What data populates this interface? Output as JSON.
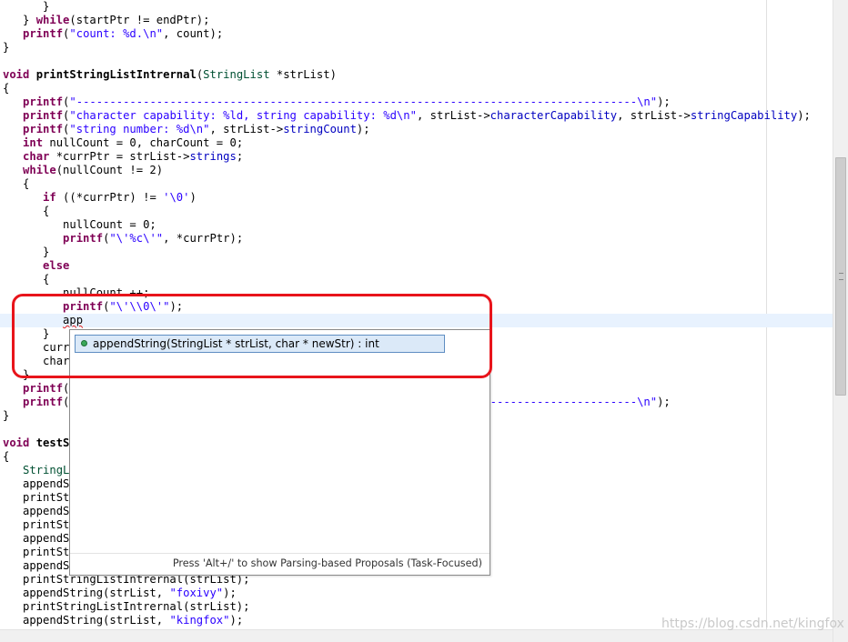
{
  "editor": {
    "lines": [
      [
        {
          "t": "      }"
        }
      ],
      [
        {
          "t": "   } "
        },
        {
          "t": "while",
          "c": "kw"
        },
        {
          "t": "(startPtr != endPtr);"
        }
      ],
      [
        {
          "t": "   printf",
          "c": "kw"
        },
        {
          "t": "("
        },
        {
          "t": "\"count: %d.\\n\"",
          "c": "str"
        },
        {
          "t": ", count);"
        }
      ],
      [
        {
          "t": "}"
        }
      ],
      [
        {
          "t": ""
        }
      ],
      [
        {
          "t": "void",
          "c": "kw"
        },
        {
          "t": " "
        },
        {
          "t": "printStringListIntrernal",
          "c": "fnd"
        },
        {
          "t": "("
        },
        {
          "t": "StringList",
          "c": "typ"
        },
        {
          "t": " *strList)"
        }
      ],
      [
        {
          "t": "{"
        }
      ],
      [
        {
          "t": "   "
        },
        {
          "t": "printf",
          "c": "kw"
        },
        {
          "t": "("
        },
        {
          "t": "\"------------------------------------------------------------------------------------\\n\"",
          "c": "str"
        },
        {
          "t": ");"
        }
      ],
      [
        {
          "t": "   "
        },
        {
          "t": "printf",
          "c": "kw"
        },
        {
          "t": "("
        },
        {
          "t": "\"character capability: %ld, string capability: %d\\n\"",
          "c": "str"
        },
        {
          "t": ", strList->"
        },
        {
          "t": "characterCapability",
          "c": "fld"
        },
        {
          "t": ", strList->"
        },
        {
          "t": "stringCapability",
          "c": "fld"
        },
        {
          "t": ");"
        }
      ],
      [
        {
          "t": "   "
        },
        {
          "t": "printf",
          "c": "kw"
        },
        {
          "t": "("
        },
        {
          "t": "\"string number: %d\\n\"",
          "c": "str"
        },
        {
          "t": ", strList->"
        },
        {
          "t": "stringCount",
          "c": "fld"
        },
        {
          "t": ");"
        }
      ],
      [
        {
          "t": "   "
        },
        {
          "t": "int",
          "c": "kw"
        },
        {
          "t": " nullCount = 0, charCount = 0;"
        }
      ],
      [
        {
          "t": "   "
        },
        {
          "t": "char",
          "c": "kw"
        },
        {
          "t": " *currPtr = strList->"
        },
        {
          "t": "strings",
          "c": "fld"
        },
        {
          "t": ";"
        }
      ],
      [
        {
          "t": "   "
        },
        {
          "t": "while",
          "c": "kw"
        },
        {
          "t": "(nullCount != 2)"
        }
      ],
      [
        {
          "t": "   {"
        }
      ],
      [
        {
          "t": "      "
        },
        {
          "t": "if",
          "c": "kw"
        },
        {
          "t": " ((*currPtr) != "
        },
        {
          "t": "'\\0'",
          "c": "str"
        },
        {
          "t": ")"
        }
      ],
      [
        {
          "t": "      {"
        }
      ],
      [
        {
          "t": "         nullCount = 0;"
        }
      ],
      [
        {
          "t": "         "
        },
        {
          "t": "printf",
          "c": "kw"
        },
        {
          "t": "("
        },
        {
          "t": "\"\\'%c\\'\"",
          "c": "str"
        },
        {
          "t": ", *currPtr);"
        }
      ],
      [
        {
          "t": "      }"
        }
      ],
      [
        {
          "t": "      "
        },
        {
          "t": "else",
          "c": "kw"
        }
      ],
      [
        {
          "t": "      {"
        }
      ],
      [
        {
          "t": "         nullCount ++;"
        }
      ],
      [
        {
          "t": "         "
        },
        {
          "t": "printf",
          "c": "kw"
        },
        {
          "t": "("
        },
        {
          "t": "\"\\'\\\\0\\'\"",
          "c": "str"
        },
        {
          "t": ");"
        }
      ],
      [
        {
          "t": "         "
        },
        {
          "t": "app",
          "c": "squig"
        }
      ],
      [
        {
          "t": "      }"
        }
      ],
      [
        {
          "t": "      curr"
        }
      ],
      [
        {
          "t": "      char"
        }
      ],
      [
        {
          "t": "   }"
        }
      ],
      [
        {
          "t": "   "
        },
        {
          "t": "printf",
          "c": "kw"
        },
        {
          "t": "("
        }
      ],
      [
        {
          "t": "   "
        },
        {
          "t": "printf",
          "c": "kw"
        },
        {
          "t": "("
        },
        {
          "t": "                                                            "
        },
        {
          "t": "-------------------------\\n\"",
          "c": "str"
        },
        {
          "t": ");"
        }
      ],
      [
        {
          "t": "}"
        }
      ],
      [
        {
          "t": ""
        }
      ],
      [
        {
          "t": "void",
          "c": "kw"
        },
        {
          "t": " "
        },
        {
          "t": "testS",
          "c": "fnd"
        }
      ],
      [
        {
          "t": "{"
        }
      ],
      [
        {
          "t": "   "
        },
        {
          "t": "StringL",
          "c": "typ"
        }
      ],
      [
        {
          "t": "   appendS"
        }
      ],
      [
        {
          "t": "   printSt"
        }
      ],
      [
        {
          "t": "   appendS"
        }
      ],
      [
        {
          "t": "   printSt"
        }
      ],
      [
        {
          "t": "   appendS"
        }
      ],
      [
        {
          "t": "   printSt"
        }
      ],
      [
        {
          "t": "   appendS"
        }
      ],
      [
        {
          "t": "   printStringListIntrernal(strList);"
        }
      ],
      [
        {
          "t": "   appendString(strList, "
        },
        {
          "t": "\"foxivy\"",
          "c": "str"
        },
        {
          "t": ");"
        }
      ],
      [
        {
          "t": "   printStringListIntrernal(strList);"
        }
      ],
      [
        {
          "t": "   appendString(strList, "
        },
        {
          "t": "\"kingfox\"",
          "c": "str"
        },
        {
          "t": ");"
        }
      ]
    ]
  },
  "autocomplete": {
    "proposal": "appendString(StringList * strList, char * newStr) : int",
    "proposal_icon": "public-function-icon",
    "status": "Press 'Alt+/' to show Parsing-based Proposals (Task-Focused)"
  },
  "annotation": {
    "color": "#e8141b"
  },
  "watermark": "https://blog.csdn.net/kingfox"
}
